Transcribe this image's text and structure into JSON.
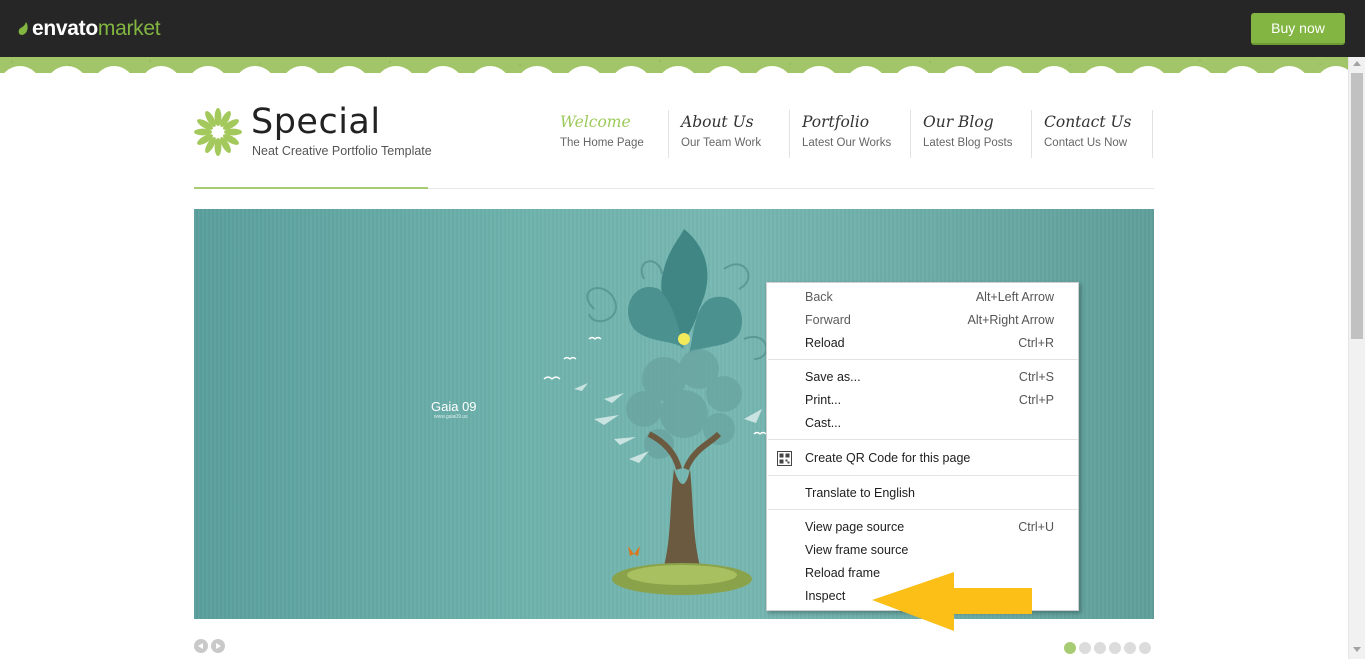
{
  "envato": {
    "logo_envato": "envato",
    "logo_market": "market",
    "buy_label": "Buy now",
    "accent": "#82b541"
  },
  "site": {
    "brand": {
      "title": "Special",
      "tagline": "Neat Creative Portfolio Template",
      "accent": "#9cc95a"
    },
    "nav": [
      {
        "title": "Welcome",
        "sub": "The Home Page",
        "active": true
      },
      {
        "title": "About Us",
        "sub": "Our Team Work",
        "active": false
      },
      {
        "title": "Portfolio",
        "sub": "Latest Our Works",
        "active": false
      },
      {
        "title": "Our Blog",
        "sub": "Latest Blog Posts",
        "active": false
      },
      {
        "title": "Contact Us",
        "sub": "Contact Us Now",
        "active": false
      }
    ],
    "slider": {
      "caption": "Gaia 09",
      "caption_url": "www.gaia09.us",
      "dots_total": 6,
      "active_dot": 1
    }
  },
  "context_menu": {
    "items": [
      {
        "label": "Back",
        "shortcut": "Alt+Left Arrow",
        "enabled": false
      },
      {
        "label": "Forward",
        "shortcut": "Alt+Right Arrow",
        "enabled": false
      },
      {
        "label": "Reload",
        "shortcut": "Ctrl+R",
        "enabled": true
      },
      {
        "label": "Save as...",
        "shortcut": "Ctrl+S",
        "enabled": true
      },
      {
        "label": "Print...",
        "shortcut": "Ctrl+P",
        "enabled": true
      },
      {
        "label": "Cast...",
        "shortcut": "",
        "enabled": true
      },
      {
        "label": "Create QR Code for this page",
        "shortcut": "",
        "icon": "qr-code-icon",
        "enabled": true
      },
      {
        "label": "Translate to English",
        "shortcut": "",
        "enabled": true
      },
      {
        "label": "View page source",
        "shortcut": "Ctrl+U",
        "enabled": true
      },
      {
        "label": "View frame source",
        "shortcut": "",
        "enabled": true
      },
      {
        "label": "Reload frame",
        "shortcut": "",
        "enabled": true
      },
      {
        "label": "Inspect",
        "shortcut": "",
        "enabled": true
      }
    ]
  },
  "annotation": {
    "arrow_color": "#fbbf17",
    "arrow_icon": "highlight-arrow-icon"
  }
}
